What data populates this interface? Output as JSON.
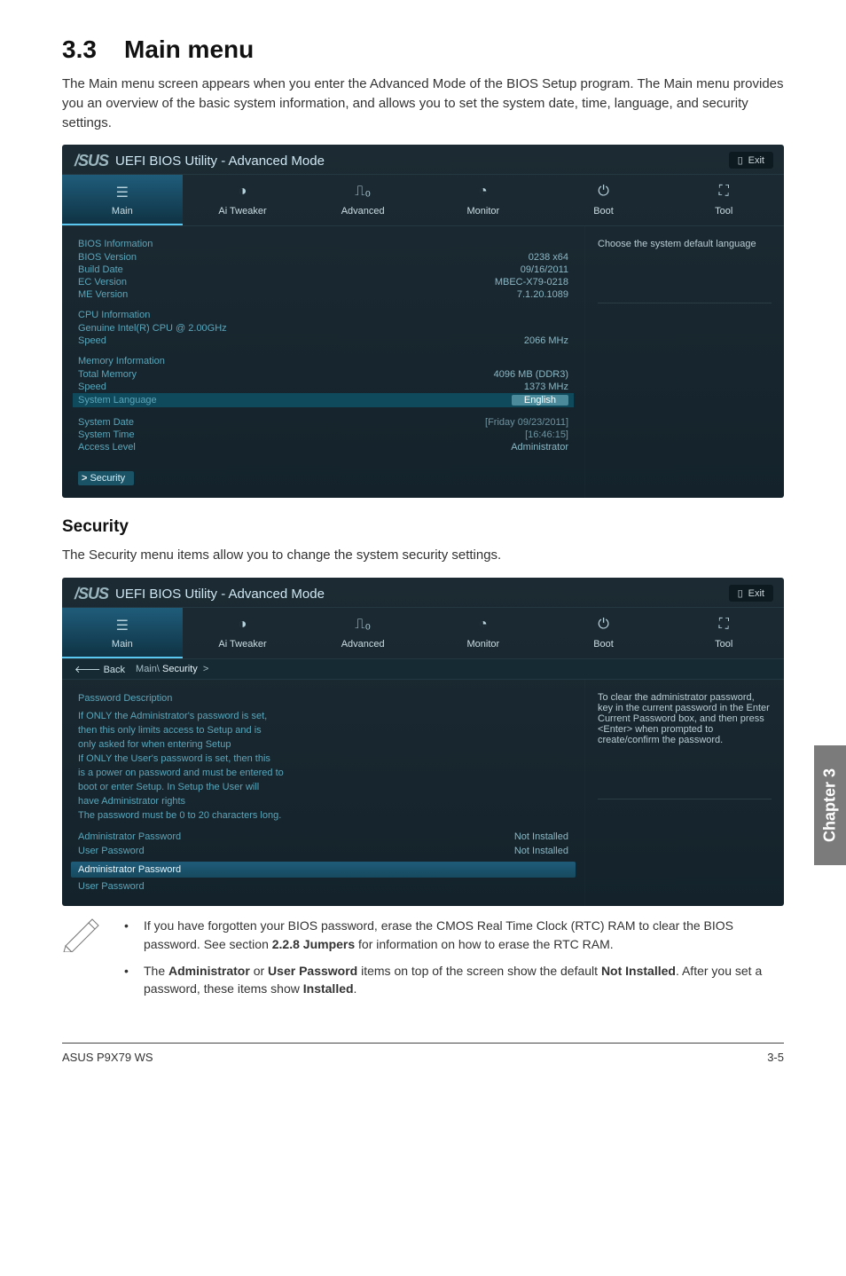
{
  "section": {
    "number": "3.3",
    "title": "Main menu"
  },
  "intro": "The Main menu screen appears when you enter the Advanced Mode of the BIOS Setup program. The Main menu provides you an overview of the basic system information, and allows you to set the system date, time, language, and security settings.",
  "bios_common": {
    "brand": "/SUS",
    "title": "UEFI BIOS Utility - Advanced Mode",
    "exit": "Exit",
    "tabs": [
      "Main",
      "Ai  Tweaker",
      "Advanced",
      "Monitor",
      "Boot",
      "Tool"
    ]
  },
  "bios1": {
    "help": "Choose the system default language",
    "groups": {
      "bios_info_heading": "BIOS Information",
      "bios_version_label": "BIOS Version",
      "bios_version_val": "0238 x64",
      "build_date_label": "Build Date",
      "build_date_val": "09/16/2011",
      "ec_version_label": "EC Version",
      "ec_version_val": "MBEC-X79-0218",
      "me_version_label": "ME Version",
      "me_version_val": "7.1.20.1089",
      "cpu_info_heading": "CPU Information",
      "cpu_name": "Genuine Intel(R) CPU @ 2.00GHz",
      "speed_label": "Speed",
      "speed_val": "2066 MHz",
      "mem_info_heading": "Memory Information",
      "total_mem_label": "Total Memory",
      "total_mem_val": "4096 MB (DDR3)",
      "mem_speed_label": "Speed",
      "mem_speed_val": "1373 MHz",
      "sys_lang_label": "System Language",
      "sys_lang_val": "English",
      "sys_date_label": "System Date",
      "sys_date_val": "[Friday 09/23/2011]",
      "sys_time_label": "System Time",
      "sys_time_val": "[16:46:15]",
      "access_label": "Access Level",
      "access_val": "Administrator",
      "security_link": "Security"
    }
  },
  "security": {
    "heading": "Security",
    "intro": "The Security menu items allow you to change the system security settings."
  },
  "bios2": {
    "back": "Back",
    "crumb_main": "Main\\",
    "crumb_current": "Security",
    "crumb_arrow": ">",
    "help": "To clear the administrator password, key in the current password in the Enter Current Password box, and then press <Enter> when prompted to create/confirm the password.",
    "desc_heading": "Password Description",
    "desc_lines": [
      "If ONLY the Administrator's password is set,",
      "then this only limits access to Setup and is",
      "only asked for when entering Setup",
      "If ONLY the User's password is set, then this",
      "is a power on password and must be entered to",
      "boot or enter Setup. In Setup the User will",
      "have Administrator rights",
      "The password must be 0 to 20 characters long."
    ],
    "admin_pwd_label": "Administrator Password",
    "admin_pwd_val": "Not Installed",
    "user_pwd_label": "User Password",
    "user_pwd_val": "Not Installed",
    "item_admin": "Administrator Password",
    "item_user": "User Password"
  },
  "notes": {
    "n1_a": "If you have forgotten your BIOS password, erase the CMOS Real Time Clock (RTC) RAM to clear the BIOS password. See section ",
    "n1_b": "2.2.8 Jumpers",
    "n1_c": " for information on how to erase the RTC RAM.",
    "n2_a": "The ",
    "n2_b": "Administrator",
    "n2_c": " or ",
    "n2_d": "User Password",
    "n2_e": " items on top of the screen show the default ",
    "n2_f": "Not Installed",
    "n2_g": ". After you set a password, these items show ",
    "n2_h": "Installed",
    "n2_i": "."
  },
  "chapter_tab": "Chapter 3",
  "footer": {
    "left": "ASUS P9X79 WS",
    "right": "3-5"
  }
}
